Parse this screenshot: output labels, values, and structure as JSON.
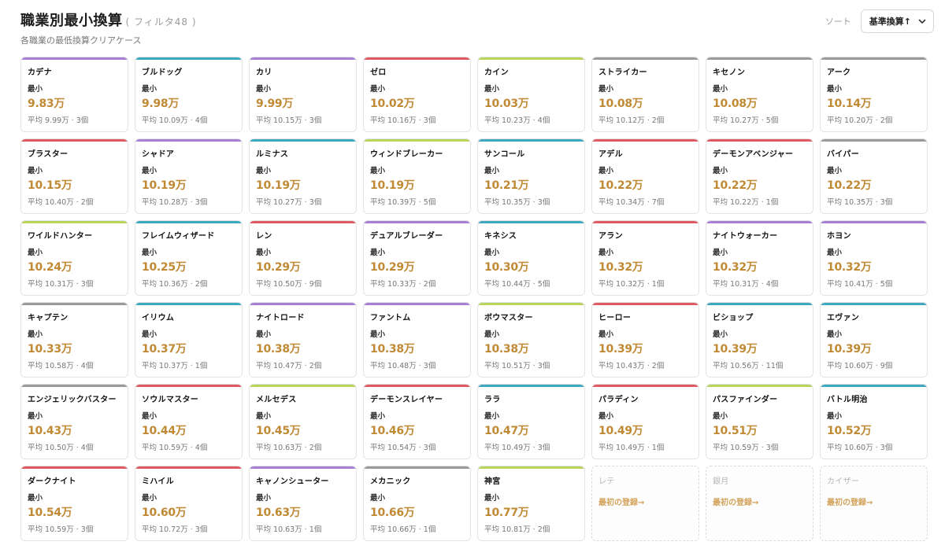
{
  "header": {
    "title": "職業別最小換算",
    "filter_note": "( フィルタ48 )",
    "subtitle": "各職業の最低換算クリアケース",
    "sort_label": "ソート",
    "sort_value": "基準換算↑"
  },
  "labels": {
    "min": "最小"
  },
  "colors": {
    "purple": "#a87fd8",
    "teal": "#3ea8c0",
    "red": "#e05a63",
    "lime": "#b9d45a",
    "gray": "#9a9a9a",
    "accent_value": "#c08a34"
  },
  "cards": [
    {
      "name": "カデナ",
      "min": "9.83万",
      "avg": "平均 9.99万 · 3個",
      "color": "purple"
    },
    {
      "name": "ブルドッグ",
      "min": "9.98万",
      "avg": "平均 10.09万 · 4個",
      "color": "teal"
    },
    {
      "name": "カリ",
      "min": "9.99万",
      "avg": "平均 10.15万 · 3個",
      "color": "purple"
    },
    {
      "name": "ゼロ",
      "min": "10.02万",
      "avg": "平均 10.16万 · 3個",
      "color": "red"
    },
    {
      "name": "カイン",
      "min": "10.03万",
      "avg": "平均 10.23万 · 4個",
      "color": "lime"
    },
    {
      "name": "ストライカー",
      "min": "10.08万",
      "avg": "平均 10.12万 · 2個",
      "color": "gray"
    },
    {
      "name": "キセノン",
      "min": "10.08万",
      "avg": "平均 10.27万 · 5個",
      "color": "gray"
    },
    {
      "name": "アーク",
      "min": "10.14万",
      "avg": "平均 10.20万 · 2個",
      "color": "gray"
    },
    {
      "name": "ブラスター",
      "min": "10.15万",
      "avg": "平均 10.40万 · 2個",
      "color": "red"
    },
    {
      "name": "シャドア",
      "min": "10.19万",
      "avg": "平均 10.28万 · 3個",
      "color": "purple"
    },
    {
      "name": "ルミナス",
      "min": "10.19万",
      "avg": "平均 10.27万 · 3個",
      "color": "teal"
    },
    {
      "name": "ウィンドブレーカー",
      "min": "10.19万",
      "avg": "平均 10.39万 · 5個",
      "color": "lime"
    },
    {
      "name": "サンコール",
      "min": "10.21万",
      "avg": "平均 10.35万 · 3個",
      "color": "teal"
    },
    {
      "name": "アデル",
      "min": "10.22万",
      "avg": "平均 10.34万 · 7個",
      "color": "red"
    },
    {
      "name": "デーモンアベンジャー",
      "min": "10.22万",
      "avg": "平均 10.22万 · 1個",
      "color": "red"
    },
    {
      "name": "バイパー",
      "min": "10.22万",
      "avg": "平均 10.35万 · 3個",
      "color": "gray"
    },
    {
      "name": "ワイルドハンター",
      "min": "10.24万",
      "avg": "平均 10.31万 · 3個",
      "color": "lime"
    },
    {
      "name": "フレイムウィザード",
      "min": "10.25万",
      "avg": "平均 10.36万 · 2個",
      "color": "teal"
    },
    {
      "name": "レン",
      "min": "10.29万",
      "avg": "平均 10.50万 · 9個",
      "color": "red"
    },
    {
      "name": "デュアルブレーダー",
      "min": "10.29万",
      "avg": "平均 10.33万 · 2個",
      "color": "purple"
    },
    {
      "name": "キネシス",
      "min": "10.30万",
      "avg": "平均 10.44万 · 5個",
      "color": "teal"
    },
    {
      "name": "アラン",
      "min": "10.32万",
      "avg": "平均 10.32万 · 1個",
      "color": "red"
    },
    {
      "name": "ナイトウォーカー",
      "min": "10.32万",
      "avg": "平均 10.31万 · 4個",
      "color": "purple"
    },
    {
      "name": "ホヨン",
      "min": "10.32万",
      "avg": "平均 10.41万 · 5個",
      "color": "purple"
    },
    {
      "name": "キャプテン",
      "min": "10.33万",
      "avg": "平均 10.58万 · 4個",
      "color": "gray"
    },
    {
      "name": "イリウム",
      "min": "10.37万",
      "avg": "平均 10.37万 · 1個",
      "color": "teal"
    },
    {
      "name": "ナイトロード",
      "min": "10.38万",
      "avg": "平均 10.47万 · 2個",
      "color": "purple"
    },
    {
      "name": "ファントム",
      "min": "10.38万",
      "avg": "平均 10.48万 · 3個",
      "color": "purple"
    },
    {
      "name": "ボウマスター",
      "min": "10.38万",
      "avg": "平均 10.51万 · 3個",
      "color": "lime"
    },
    {
      "name": "ヒーロー",
      "min": "10.39万",
      "avg": "平均 10.43万 · 2個",
      "color": "red"
    },
    {
      "name": "ビショップ",
      "min": "10.39万",
      "avg": "平均 10.56万 · 11個",
      "color": "teal"
    },
    {
      "name": "エヴァン",
      "min": "10.39万",
      "avg": "平均 10.60万 · 9個",
      "color": "teal"
    },
    {
      "name": "エンジェリックバスター",
      "min": "10.43万",
      "avg": "平均 10.50万 · 4個",
      "color": "gray"
    },
    {
      "name": "ソウルマスター",
      "min": "10.44万",
      "avg": "平均 10.59万 · 4個",
      "color": "red"
    },
    {
      "name": "メルセデス",
      "min": "10.45万",
      "avg": "平均 10.63万 · 2個",
      "color": "lime"
    },
    {
      "name": "デーモンスレイヤー",
      "min": "10.46万",
      "avg": "平均 10.54万 · 3個",
      "color": "red"
    },
    {
      "name": "ララ",
      "min": "10.47万",
      "avg": "平均 10.49万 · 3個",
      "color": "teal"
    },
    {
      "name": "パラディン",
      "min": "10.49万",
      "avg": "平均 10.49万 · 1個",
      "color": "red"
    },
    {
      "name": "パスファインダー",
      "min": "10.51万",
      "avg": "平均 10.59万 · 3個",
      "color": "lime"
    },
    {
      "name": "バトル明治",
      "min": "10.52万",
      "avg": "平均 10.60万 · 3個",
      "color": "teal"
    },
    {
      "name": "ダークナイト",
      "min": "10.54万",
      "avg": "平均 10.59万 · 3個",
      "color": "red"
    },
    {
      "name": "ミハイル",
      "min": "10.60万",
      "avg": "平均 10.72万 · 3個",
      "color": "red"
    },
    {
      "name": "キャノンシューター",
      "min": "10.63万",
      "avg": "平均 10.63万 · 1個",
      "color": "purple"
    },
    {
      "name": "メカニック",
      "min": "10.66万",
      "avg": "平均 10.66万 · 1個",
      "color": "gray"
    },
    {
      "name": "神宮",
      "min": "10.77万",
      "avg": "平均 10.81万 · 2個",
      "color": "lime"
    },
    {
      "name": "レテ",
      "empty": true,
      "register": "最初の登録→"
    },
    {
      "name": "銀月",
      "empty": true,
      "register": "最初の登録→"
    },
    {
      "name": "カイザー",
      "empty": true,
      "register": "最初の登録→"
    }
  ]
}
